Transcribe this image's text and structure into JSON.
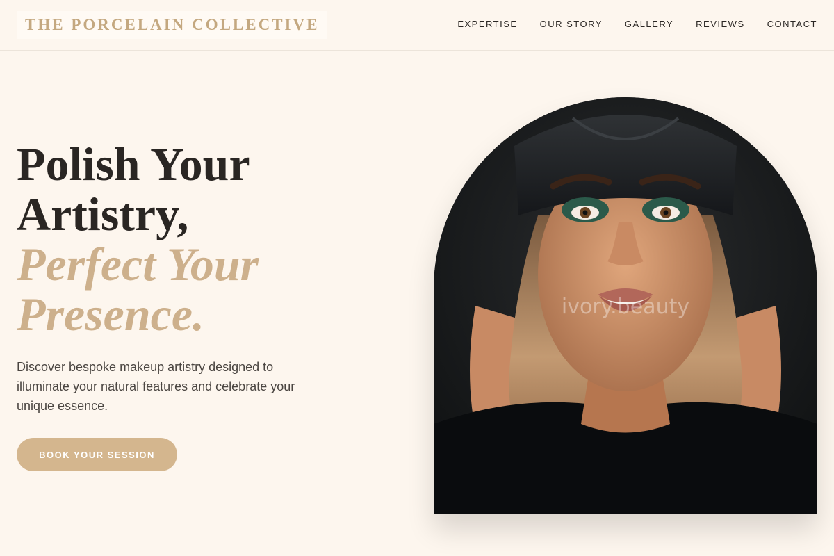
{
  "header": {
    "logo": "THE PORCELAIN COLLECTIVE",
    "nav": [
      "EXPERTISE",
      "OUR STORY",
      "GALLERY",
      "REVIEWS",
      "CONTACT"
    ]
  },
  "hero": {
    "headline_line1": "Polish Your",
    "headline_line2": "Artistry,",
    "headline_accent1": "Perfect Your",
    "headline_accent2": "Presence.",
    "description": "Discover bespoke makeup artistry designed to illuminate your natural features and celebrate your unique essence.",
    "cta_label": "BOOK YOUR SESSION",
    "photo_watermark": "ivory.beauty"
  },
  "colors": {
    "background": "#fdf6ee",
    "accent": "#cdb08c",
    "button": "#d4b68e",
    "text": "#2a2623"
  }
}
